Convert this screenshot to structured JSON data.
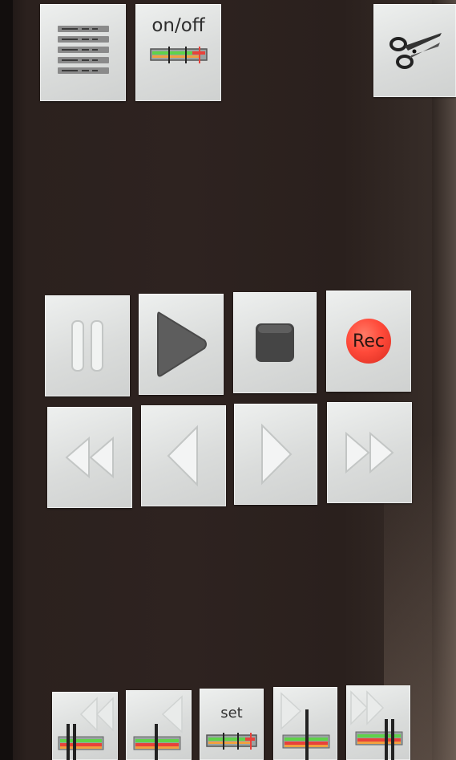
{
  "top_bar": {
    "menu_icon": "list-menu-icon",
    "onoff_label": "on/off",
    "cut_icon": "scissors-icon"
  },
  "transport": {
    "pause_icon": "pause-icon",
    "play_icon": "play-icon",
    "stop_icon": "stop-icon",
    "rec_label": "Rec",
    "rewind_icon": "rewind-icon",
    "step_back_icon": "step-back-icon",
    "step_forward_icon": "step-forward-icon",
    "fast_forward_icon": "fast-forward-icon"
  },
  "bottom_bar": {
    "set_label": "set",
    "jump_start_icon": "jump-to-start-icon",
    "jump_prev_marker_icon": "jump-to-previous-marker-icon",
    "jump_next_marker_icon": "jump-to-next-marker-icon",
    "jump_end_icon": "jump-to-end-icon"
  },
  "colors": {
    "button_face": "#dcdedd",
    "rec_red": "#ff4a3a",
    "level_green": "#5fd24a",
    "level_red": "#e8423a",
    "level_orange": "#f0a040"
  }
}
